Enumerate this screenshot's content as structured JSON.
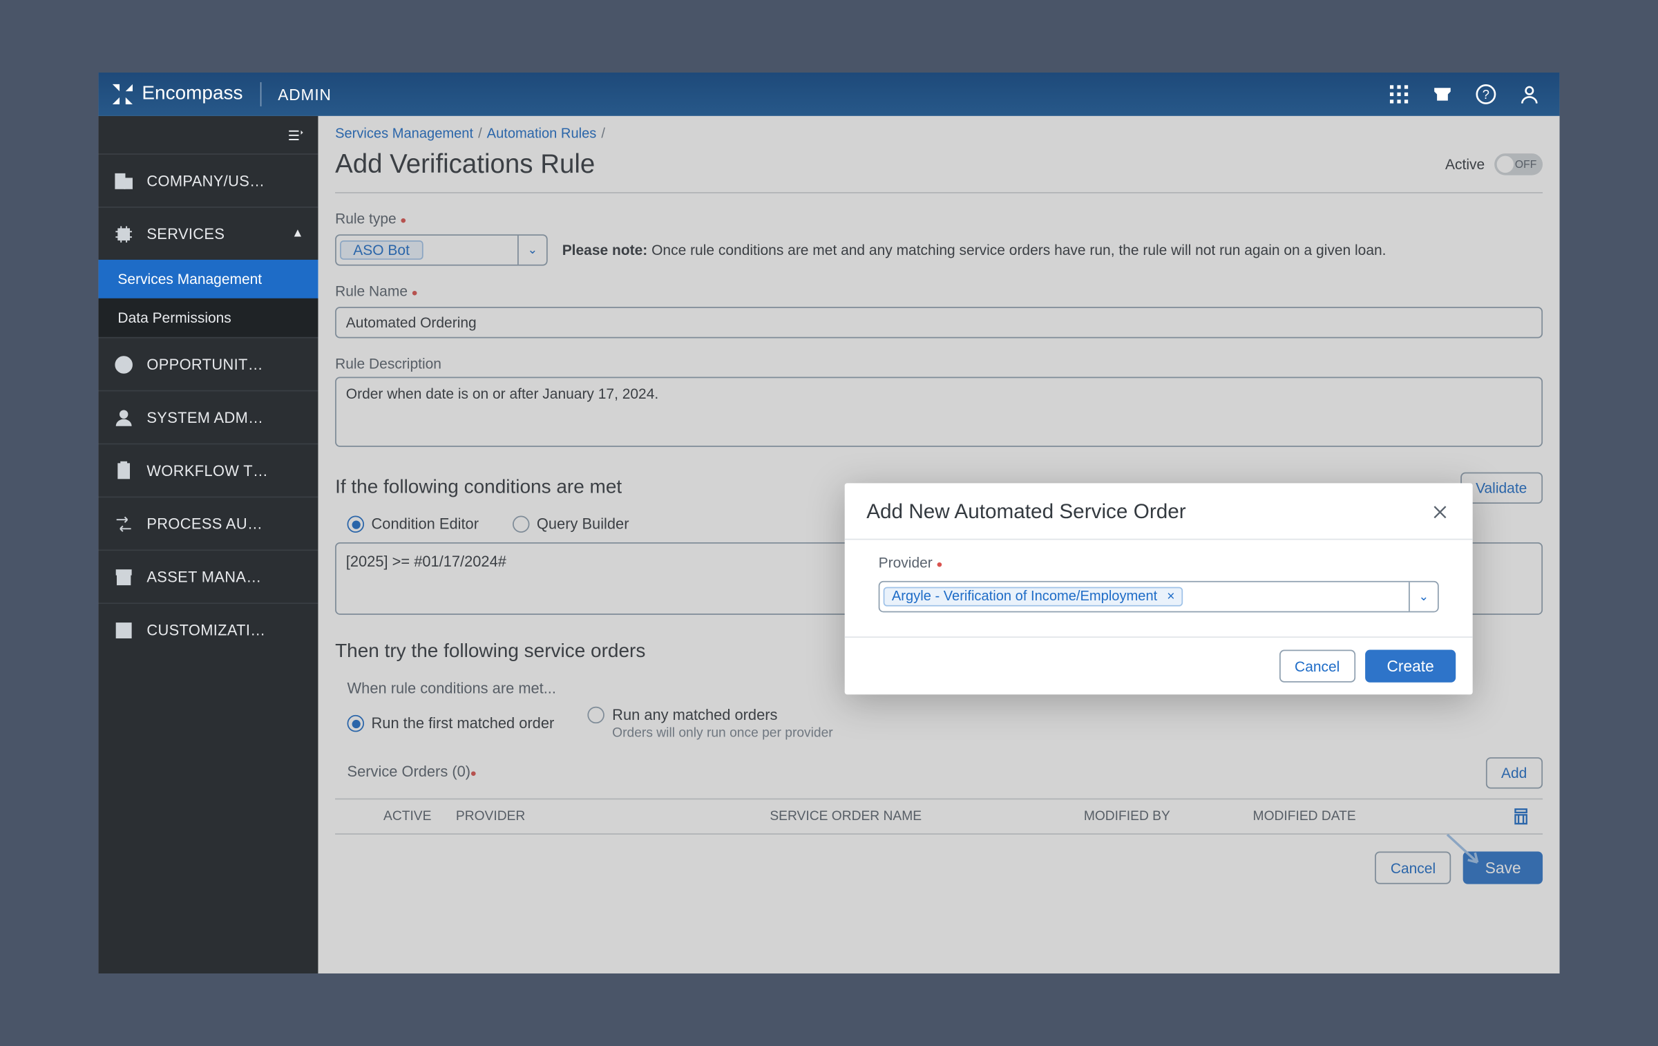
{
  "brand": "Encompass",
  "titlebar_badge": "ADMIN",
  "sidebar": {
    "items": [
      {
        "label": "COMPANY/US…"
      },
      {
        "label": "SERVICES"
      },
      {
        "label": "OPPORTUNIT…"
      },
      {
        "label": "SYSTEM ADM…"
      },
      {
        "label": "WORKFLOW T…"
      },
      {
        "label": "PROCESS AU…"
      },
      {
        "label": "ASSET MANA…"
      },
      {
        "label": "CUSTOMIZATI…"
      }
    ],
    "sub_services": {
      "management": "Services Management",
      "permissions": "Data Permissions"
    }
  },
  "breadcrumb": {
    "a": "Services Management",
    "b": "Automation Rules"
  },
  "page_title": "Add Verifications Rule",
  "active_label": "Active",
  "toggle_off": "OFF",
  "rule_type_label": "Rule type",
  "rule_type_value": "ASO Bot",
  "note_prefix": "Please note:",
  "note_body": " Once rule conditions are met and any matching service orders have run, the rule will not run again on a given loan.",
  "rule_name_label": "Rule Name",
  "rule_name_value": "Automated Ordering",
  "rule_desc_label": "Rule Description",
  "rule_desc_value": "Order when date is on or after January 17, 2024.",
  "cond_section_title": "If the following conditions are met",
  "validate_btn": "Validate",
  "cond_editor": "Condition Editor",
  "query_builder": "Query Builder",
  "cond_expr": "[2025] >= #01/17/2024#",
  "orders_section_title": "Then try the following service orders",
  "when_met_label": "When rule conditions are met...",
  "run_first": "Run the first matched order",
  "run_any": "Run any matched orders",
  "run_any_sub": "Orders will only run once per provider",
  "service_orders_label": "Service Orders (0)",
  "add_btn": "Add",
  "table": {
    "active": "ACTIVE",
    "provider": "PROVIDER",
    "son": "SERVICE ORDER NAME",
    "modby": "MODIFIED BY",
    "moddate": "MODIFIED DATE"
  },
  "foot": {
    "cancel": "Cancel",
    "save": "Save"
  },
  "modal": {
    "title": "Add New Automated Service Order",
    "provider_label": "Provider",
    "provider_value": "Argyle - Verification of Income/Employment",
    "cancel": "Cancel",
    "create": "Create"
  }
}
